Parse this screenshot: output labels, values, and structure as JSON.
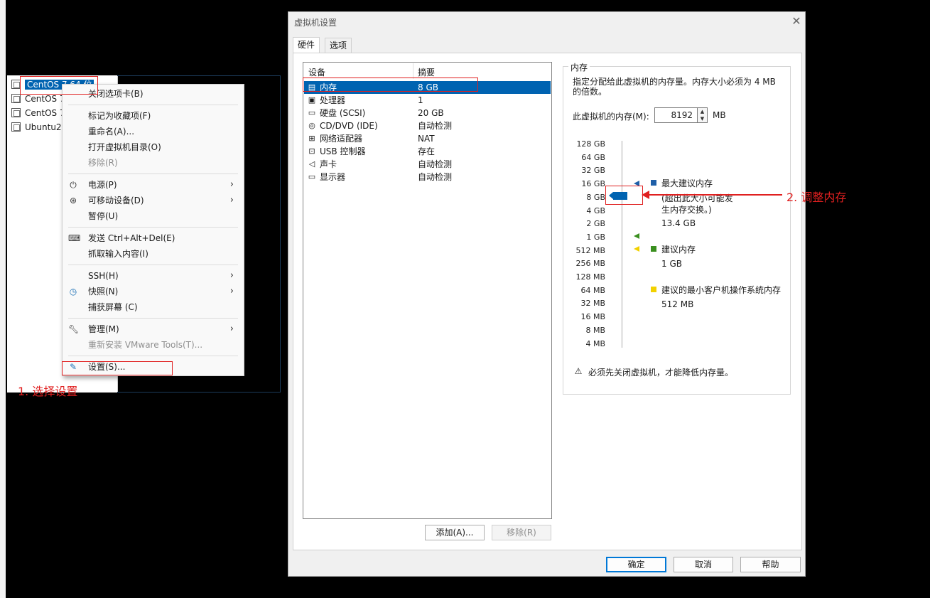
{
  "library": {
    "items": [
      {
        "label": "CentOS 7 64 位"
      },
      {
        "label": "CentOS 7"
      },
      {
        "label": "CentOS 7"
      },
      {
        "label": "Ubuntu2"
      }
    ]
  },
  "context_menu": {
    "items": [
      {
        "label": "关闭选项卡(B)"
      },
      {
        "label": "标记为收藏项(F)"
      },
      {
        "label": "重命名(A)..."
      },
      {
        "label": "打开虚拟机目录(O)"
      },
      {
        "label": "移除(R)"
      },
      {
        "label": "电源(P)"
      },
      {
        "label": "可移动设备(D)"
      },
      {
        "label": "暂停(U)"
      },
      {
        "label": "发送 Ctrl+Alt+Del(E)"
      },
      {
        "label": "抓取输入内容(I)"
      },
      {
        "label": "SSH(H)"
      },
      {
        "label": "快照(N)"
      },
      {
        "label": "捕获屏幕 (C)"
      },
      {
        "label": "管理(M)"
      },
      {
        "label": "重新安装 VMware Tools(T)..."
      },
      {
        "label": "设置(S)..."
      }
    ]
  },
  "annotations": {
    "step1": "1. 选择设置",
    "step2": "2. 调整内存"
  },
  "dialog": {
    "title": "虚拟机设置",
    "tabs": [
      {
        "label": "硬件"
      },
      {
        "label": "选项"
      }
    ],
    "device_list": {
      "headers": {
        "device": "设备",
        "summary": "摘要"
      },
      "rows": [
        {
          "name": "内存",
          "summary": "8 GB",
          "icon": "memory-icon"
        },
        {
          "name": "处理器",
          "summary": "1",
          "icon": "processor-icon"
        },
        {
          "name": "硬盘 (SCSI)",
          "summary": "20 GB",
          "icon": "hard-disk-icon"
        },
        {
          "name": "CD/DVD (IDE)",
          "summary": "自动检测",
          "icon": "cd-dvd-icon"
        },
        {
          "name": "网络适配器",
          "summary": "NAT",
          "icon": "network-adapter-icon"
        },
        {
          "name": "USB 控制器",
          "summary": "存在",
          "icon": "usb-icon"
        },
        {
          "name": "声卡",
          "summary": "自动检测",
          "icon": "speaker-icon"
        },
        {
          "name": "显示器",
          "summary": "自动检测",
          "icon": "monitor-icon"
        }
      ]
    },
    "add_button": "添加(A)...",
    "remove_button": "移除(R)",
    "memory": {
      "group_title": "内存",
      "description": "指定分配给此虚拟机的内存量。内存大小必须为 4 MB 的倍数。",
      "label": "此虚拟机的内存(M):",
      "value": "8192",
      "unit": "MB",
      "scale_ticks": [
        "128 GB",
        "64 GB",
        "32 GB",
        "16 GB",
        "8 GB",
        "4 GB",
        "2 GB",
        "1 GB",
        "512 MB",
        "256 MB",
        "128 MB",
        "64 MB",
        "32 MB",
        "16 MB",
        "8 MB",
        "4 MB"
      ],
      "legend": {
        "max_title": "最大建议内存",
        "max_note": "(超出此大小可能发生内存交换。)",
        "max_value": "13.4 GB",
        "rec_title": "建议内存",
        "rec_value": "1 GB",
        "min_title": "建议的最小客户机操作系统内存",
        "min_value": "512 MB"
      },
      "colors": {
        "max": "#1e5fa8",
        "recommended": "#3a8f1f",
        "minimum": "#f2d100"
      },
      "warning": "必须先关闭虚拟机，才能降低内存量。"
    },
    "buttons": {
      "ok": "确定",
      "cancel": "取消",
      "help": "帮助"
    }
  }
}
